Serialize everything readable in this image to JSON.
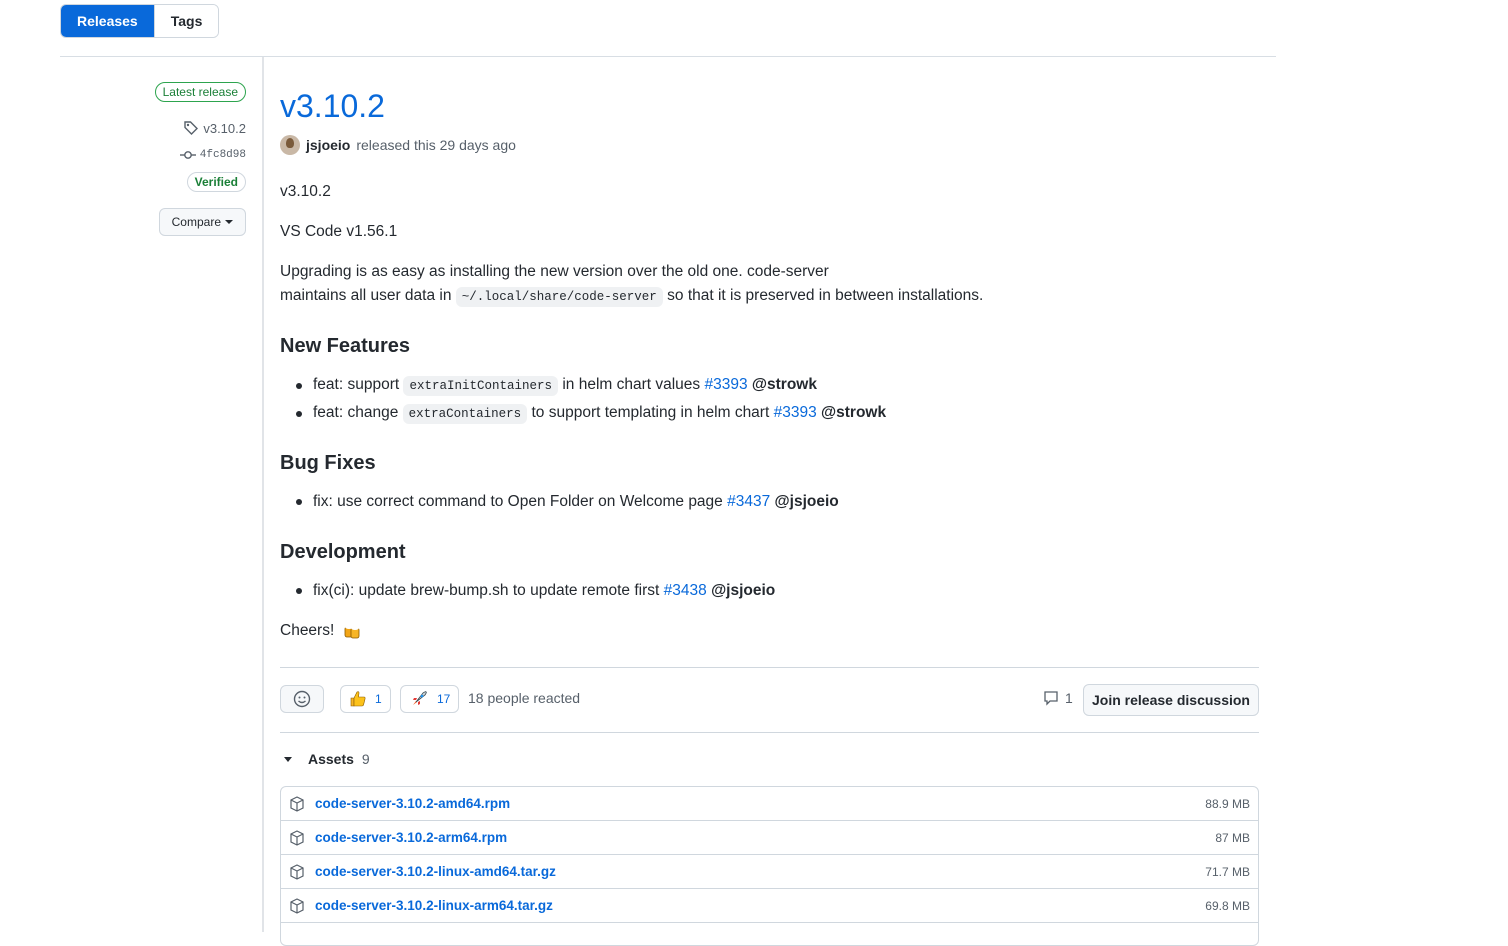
{
  "tabs": {
    "releases": "Releases",
    "tags": "Tags"
  },
  "sidebar": {
    "latest": "Latest release",
    "tag": "v3.10.2",
    "commit": "4fc8d98",
    "verified": "Verified",
    "compare": "Compare"
  },
  "release": {
    "title": "v3.10.2",
    "author": "jsjoeio",
    "released_text": "released this 29 days ago",
    "p1": "v3.10.2",
    "p2": "VS Code v1.56.1",
    "p3_line1": "Upgrading is as easy as installing the new version over the old one. code-server",
    "p3_line2_pre": "maintains all user data in",
    "p3_code": "~/.local/share/code-server",
    "p3_line2_post": "so that it is preserved in between installations.",
    "new_features_heading": "New Features",
    "nf1_pre": "feat: support",
    "nf1_code": "extraInitContainers",
    "nf1_post": "in helm chart values",
    "nf1_link": "#3393",
    "nf1_mention": "@strowk",
    "nf2_pre": "feat: change",
    "nf2_code": "extraContainers",
    "nf2_post": "to support templating in helm chart",
    "nf2_link": "#3393",
    "nf2_mention": "@strowk",
    "bug_heading": "Bug Fixes",
    "bf1_text": "fix: use correct command to Open Folder on Welcome page",
    "bf1_link": "#3437",
    "bf1_mention": "@jsjoeio",
    "dev_heading": "Development",
    "dv1_text": "fix(ci): update brew-bump.sh to update remote first",
    "dv1_link": "#3438",
    "dv1_mention": "@jsjoeio",
    "cheers": "Cheers!"
  },
  "reactions": {
    "thumbs_count": "1",
    "rocket_count": "17",
    "summary": "18 people reacted",
    "comments_count": "1",
    "join_label": "Join release discussion"
  },
  "assets": {
    "label": "Assets",
    "count": "9",
    "items": [
      {
        "name": "code-server-3.10.2-amd64.rpm",
        "size": "88.9 MB"
      },
      {
        "name": "code-server-3.10.2-arm64.rpm",
        "size": "87 MB"
      },
      {
        "name": "code-server-3.10.2-linux-amd64.tar.gz",
        "size": "71.7 MB"
      },
      {
        "name": "code-server-3.10.2-linux-arm64.tar.gz",
        "size": "69.8 MB"
      }
    ]
  }
}
